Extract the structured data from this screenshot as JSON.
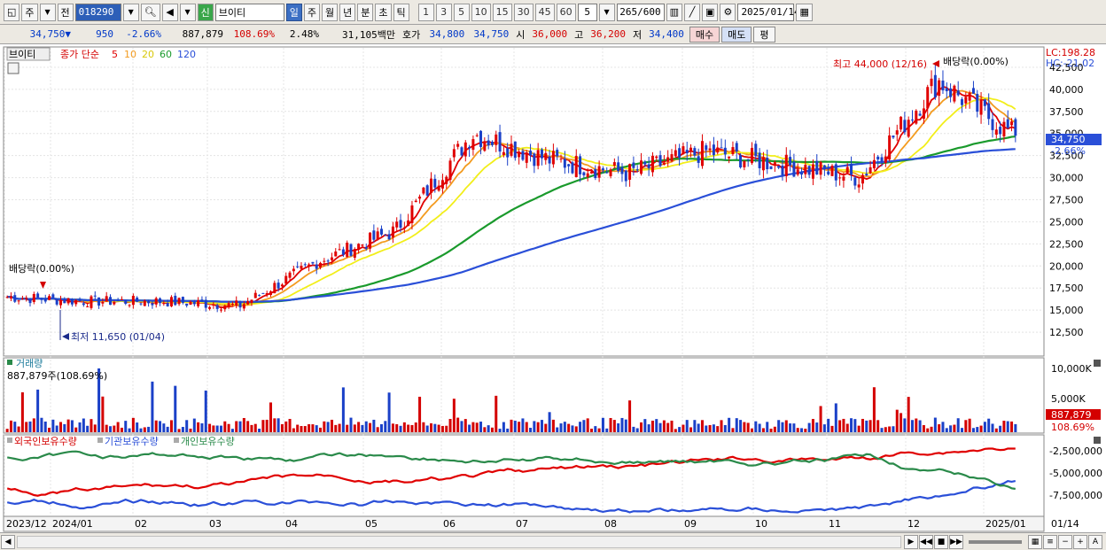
{
  "toolbar": {
    "period_type": "주",
    "prev_label": "전",
    "code": "018290",
    "credit_badge": "신",
    "stock_name": "브이티",
    "period_tabs": [
      "일",
      "주",
      "월",
      "년",
      "분",
      "초",
      "틱"
    ],
    "active_tab": "일",
    "interval_buttons": [
      "1",
      "3",
      "5",
      "10",
      "15",
      "30",
      "45",
      "60"
    ],
    "interval_value": "5",
    "count_display": "265",
    "count_total": "/600",
    "date": "2025/01/14"
  },
  "quote": {
    "price": "34,750",
    "change_arrow": "▼",
    "change": "950",
    "change_pct": "-2.66%",
    "volume": "887,879",
    "volume_ratio": "108.69%",
    "turnover_rate": "2.48%",
    "amount": "31,105백만",
    "hoga_label": "호가",
    "bid": "34,800",
    "ask": "34,750",
    "open_label": "시",
    "open": "36,000",
    "high_label": "고",
    "high": "36,200",
    "low_label": "저",
    "low": "34,400",
    "buy_label": "매수",
    "sell_label": "매도",
    "eval_label": "평"
  },
  "panels": {
    "price_legend": {
      "tab": "브이티",
      "ma_label": "종가 단순",
      "ma_periods": [
        "5",
        "10",
        "20",
        "60",
        "120"
      ],
      "ma_colors": [
        "#e00000",
        "#f39b1f",
        "#f2ee1a",
        "#1a9a2c",
        "#2a4fd8"
      ]
    },
    "lc_label": "LC:198.28",
    "hc_label": "HC:-21.02",
    "high_marker": "최고 44,000 (12/16)",
    "low_marker": "최저 11,650 (01/04)",
    "dividend_left": "배당락(0.00%)",
    "dividend_right": "배당락(0.00%)",
    "current_price_tag": "34,750",
    "current_pct_tag": "-2.66%",
    "volume_title": "거래량",
    "volume_info": "887,879주(108.69%)",
    "volume_axis": [
      "10,000K",
      "5,000K"
    ],
    "volume_tag": "887,879",
    "volume_pct_tag": "108.69%",
    "holdings_legend": [
      "외국인보유수량",
      "기관보유수량",
      "개인보유수량"
    ],
    "holdings_colors": [
      "#e00000",
      "#2a4fd8",
      "#2a8a4a"
    ],
    "holdings_axis": [
      "-2,500,000",
      "-5,000,000",
      "-7,500,000"
    ],
    "x_labels": [
      "2023/12",
      "2024/01",
      "02",
      "03",
      "04",
      "05",
      "06",
      "07",
      "08",
      "09",
      "10",
      "11",
      "12",
      "2025/01"
    ],
    "x_right_label": "01/14"
  },
  "chart_data": [
    {
      "type": "candlestick",
      "title": "브이티",
      "yaxis_ticks": [
        12500,
        15000,
        17500,
        20000,
        22500,
        25000,
        27500,
        30000,
        32500,
        35000,
        37500,
        40000,
        42500
      ],
      "ylim": [
        10000,
        44500
      ],
      "x_months": [
        "2023/12",
        "2024/01",
        "02",
        "03",
        "04",
        "05",
        "06",
        "07",
        "08",
        "09",
        "10",
        "11",
        "12",
        "2025/01"
      ],
      "monthly_close_approx": [
        16500,
        16000,
        16000,
        15500,
        20500,
        24000,
        35000,
        32000,
        30500,
        33000,
        31500,
        30000,
        41000,
        34750
      ],
      "annotations": [
        {
          "label": "최고 44,000 (12/16)",
          "value": 44000
        },
        {
          "label": "최저 11,650 (01/04)",
          "value": 11650
        }
      ],
      "last_price": 34750
    },
    {
      "type": "bar",
      "title": "거래량",
      "yaxis_ticks": [
        "5,000K",
        "10,000K"
      ],
      "last_value": 887879
    },
    {
      "type": "line",
      "series": [
        {
          "name": "외국인보유수량"
        },
        {
          "name": "기관보유수량"
        },
        {
          "name": "개인보유수량"
        }
      ],
      "yaxis_ticks": [
        -2500000,
        -5000000,
        -7500000
      ]
    }
  ]
}
